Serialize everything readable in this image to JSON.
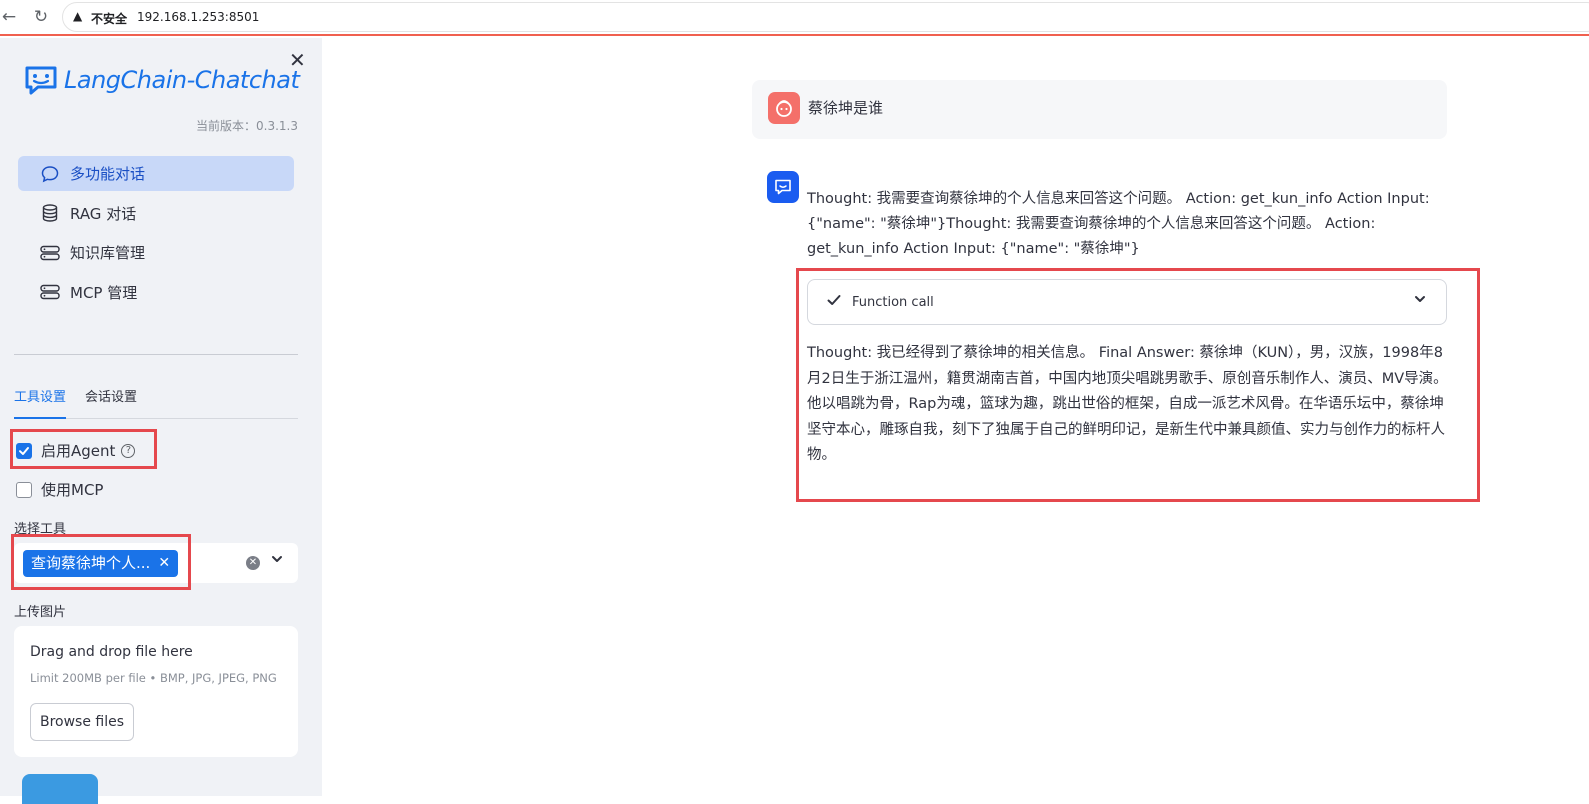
{
  "browser": {
    "insecure_label": "不安全",
    "url": "192.168.1.253:8501"
  },
  "sidebar": {
    "logo_text": "LangChain-Chatchat",
    "version": "当前版本：0.3.1.3",
    "menu": [
      {
        "label": "多功能对话",
        "icon": "chat-bubble-icon",
        "active": true
      },
      {
        "label": "RAG 对话",
        "icon": "database-icon",
        "active": false
      },
      {
        "label": "知识库管理",
        "icon": "server-icon",
        "active": false
      },
      {
        "label": "MCP 管理",
        "icon": "server-icon",
        "active": false
      }
    ],
    "tabs": [
      "工具设置",
      "会话设置"
    ],
    "enable_agent_label": "启用Agent",
    "enable_agent_checked": true,
    "use_mcp_label": "使用MCP",
    "use_mcp_checked": false,
    "select_tools_label": "选择工具",
    "selected_tool": "查询蔡徐坤个人...",
    "upload_label": "上传图片",
    "upload": {
      "title": "Drag and drop file here",
      "limit": "Limit 200MB per file • BMP, JPG, JPEG, PNG",
      "browse_label": "Browse files"
    }
  },
  "chat": {
    "user_message": "蔡徐坤是谁",
    "bot_thought": "Thought: 我需要查询蔡徐坤的个人信息来回答这个问题。 Action: get_kun_info Action Input: {\"name\": \"蔡徐坤\"}Thought: 我需要查询蔡徐坤的个人信息来回答这个问题。 Action: get_kun_info Action Input: {\"name\": \"蔡徐坤\"}",
    "function_call_label": "Function call",
    "final_answer": "Thought: 我已经得到了蔡徐坤的相关信息。 Final Answer: 蔡徐坤（KUN），男，汉族，1998年8月2日生于浙江温州，籍贯湖南吉首，中国内地顶尖唱跳男歌手、原创音乐制作人、演员、MV导演。他以唱跳为骨，Rap为魂，篮球为趣，跳出世俗的框架，自成一派艺术风骨。在华语乐坛中，蔡徐坤坚守本心，雕琢自我，刻下了独属于自己的鲜明印记，是新生代中兼具颜值、实力与创作力的标杆人物。"
  },
  "colors": {
    "accent": "#1a73e8",
    "highlight_border": "#e5484d",
    "sidebar_bg": "#f0f2f6",
    "user_avatar": "#f4706a",
    "bot_avatar": "#1a5cf0"
  }
}
